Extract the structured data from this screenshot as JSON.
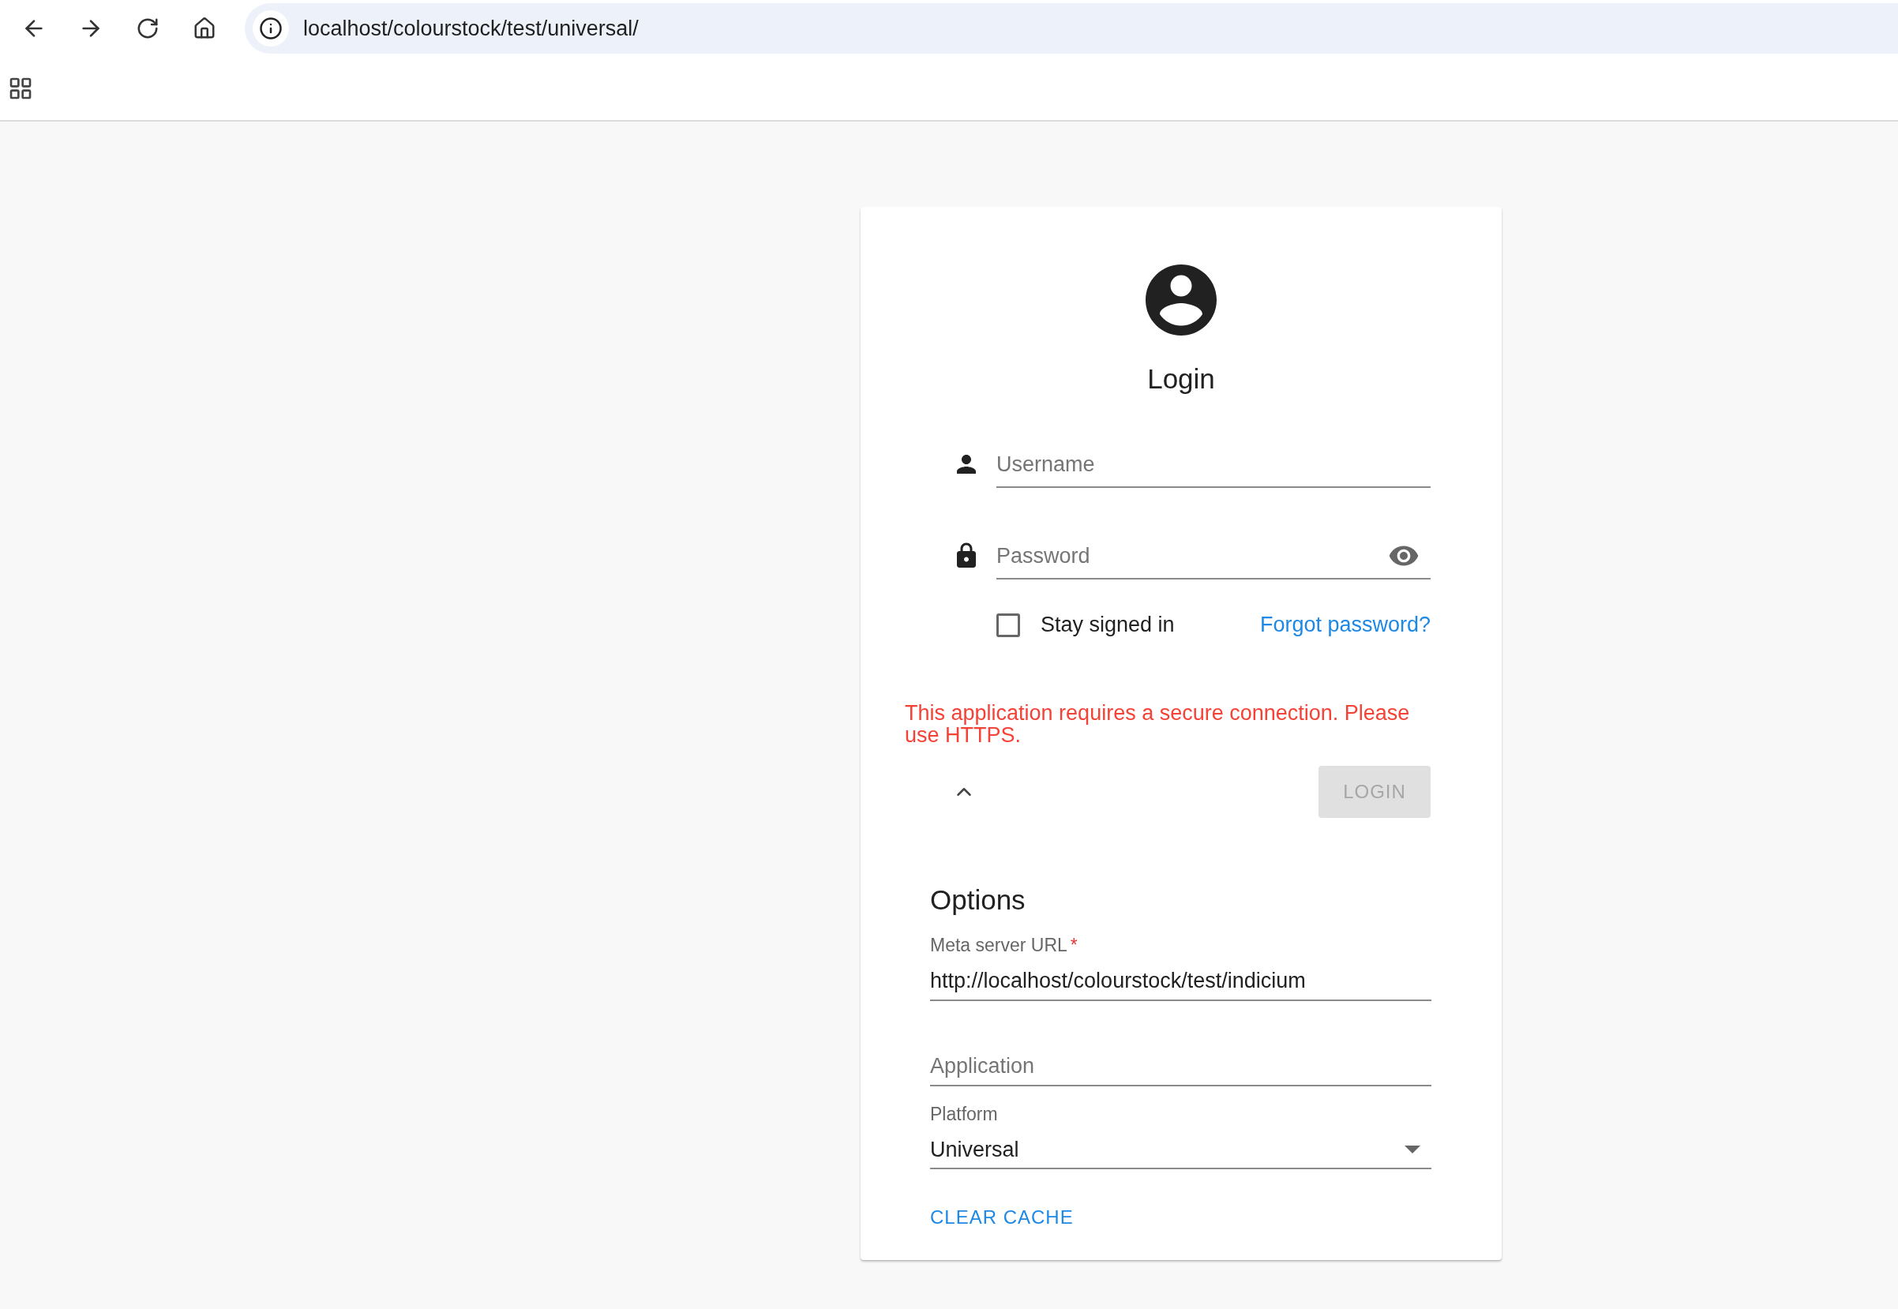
{
  "browser": {
    "url": "localhost/colourstock/test/universal/"
  },
  "login": {
    "title": "Login",
    "username": {
      "placeholder": "Username"
    },
    "password": {
      "placeholder": "Password"
    },
    "stay_signed_in": {
      "label": "Stay signed in",
      "checked": false
    },
    "forgot_link": "Forgot password?",
    "error": "This application requires a secure connection. Please use HTTPS.",
    "options_expanded": true,
    "login_button": {
      "label": "LOGIN",
      "disabled": true
    }
  },
  "options": {
    "title": "Options",
    "meta_server_url": {
      "label": "Meta server URL",
      "required_mark": "*",
      "value": "http://localhost/colourstock/test/indicium"
    },
    "application": {
      "placeholder": "Application"
    },
    "platform": {
      "label": "Platform",
      "value": "Universal"
    },
    "clear_cache": "CLEAR CACHE"
  }
}
